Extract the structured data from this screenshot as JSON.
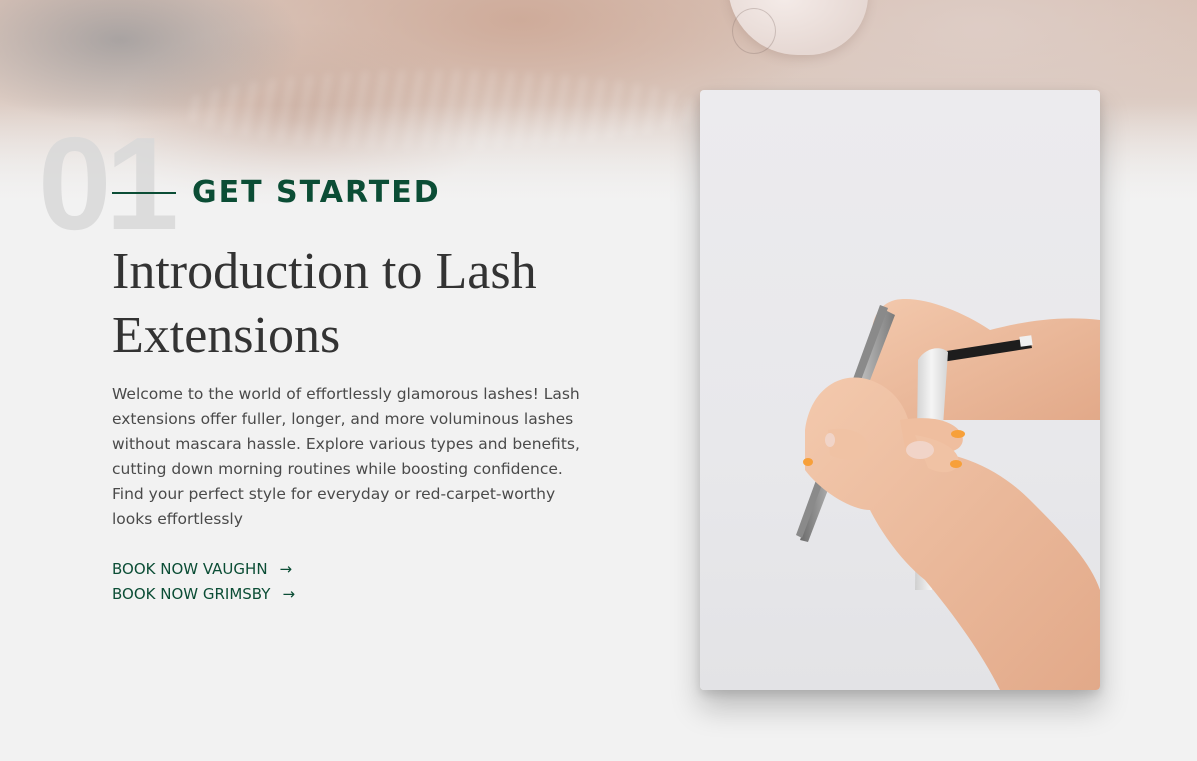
{
  "section": {
    "number": "01",
    "eyebrow": "GET STARTED",
    "title": "Introduction to Lash Extensions",
    "description": "Welcome to the world of effortlessly glamorous lashes! Lash extensions offer fuller, longer, and more voluminous lashes without mascara hassle. Explore various types and benefits, cutting down morning routines while boosting confidence. Find your perfect style for everyday or red-carpet-worthy looks effortlessly",
    "ctas": [
      {
        "label": "BOOK NOW VAUGHN",
        "icon": "arrow-right-icon"
      },
      {
        "label": "BOOK NOW GRIMSBY",
        "icon": "arrow-right-icon"
      }
    ]
  },
  "colors": {
    "accent": "#0b4d35",
    "background": "#f2f2f2",
    "heading": "#333333",
    "body_text": "#4a4a4a"
  },
  "images": {
    "hero": "blurred-eye-closeup-photo",
    "card": "hands-holding-lash-tweezers-photo"
  }
}
